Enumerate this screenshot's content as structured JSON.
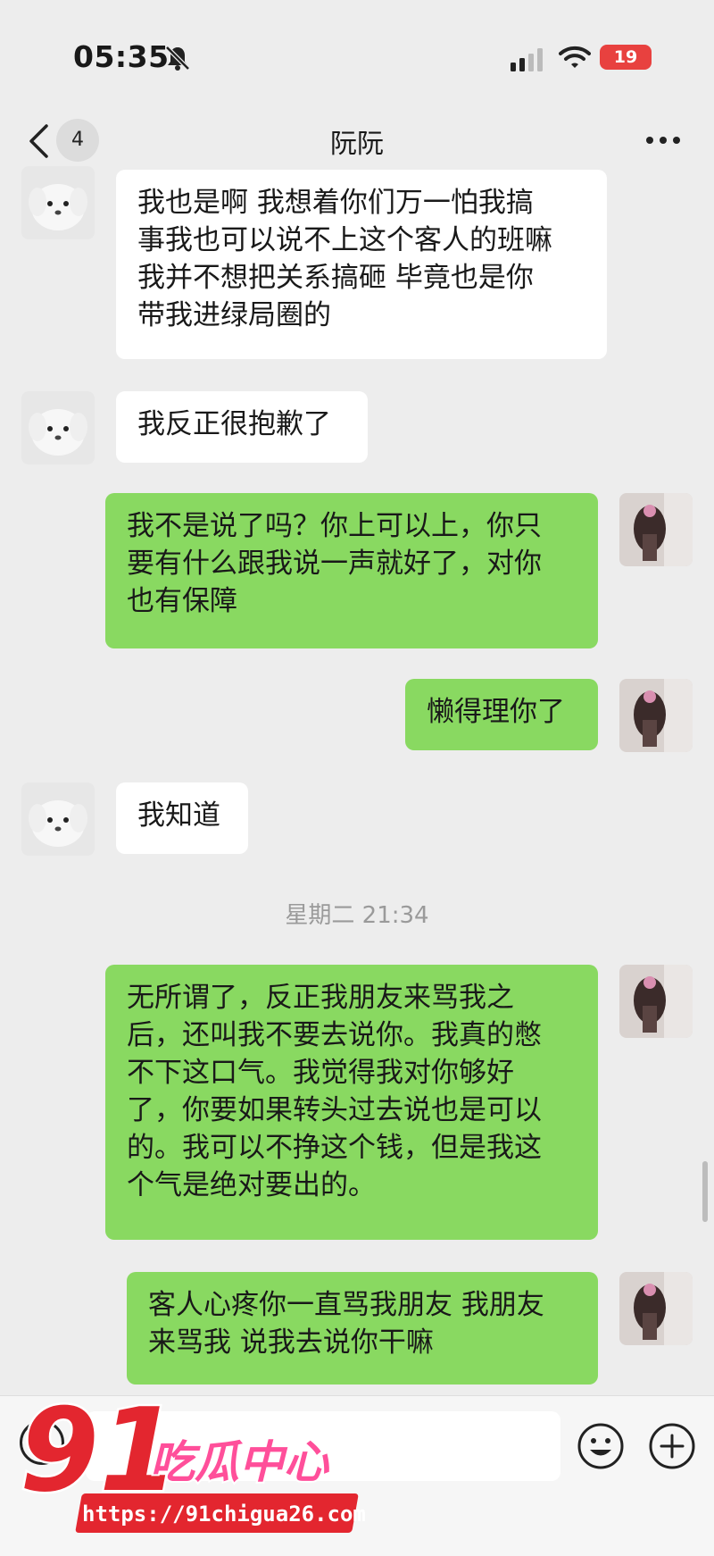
{
  "status_bar": {
    "time": "05:35",
    "battery": "19",
    "icons": [
      "bell-slash-icon",
      "signal-icon",
      "wifi-icon",
      "battery-icon"
    ]
  },
  "nav": {
    "unread_count": "4",
    "title": "阮阮",
    "icons": [
      "chevron-left-icon",
      "more-dots-icon"
    ]
  },
  "messages": [
    {
      "side": "in",
      "text": "我也是啊 我想着你们万一怕我搞\n事我也可以说不上这个客人的班嘛\n我并不想把关系搞砸 毕竟也是你\n带我进绿局圈的"
    },
    {
      "side": "in",
      "text": "我反正很抱歉了"
    },
    {
      "side": "out",
      "text": "我不是说了吗？你上可以上，你只\n要有什么跟我说一声就好了，对你\n也有保障"
    },
    {
      "side": "out",
      "text": "懒得理你了"
    },
    {
      "side": "in",
      "text": "我知道"
    },
    {
      "side": "out",
      "text": "无所谓了，反正我朋友来骂我之\n后，还叫我不要去说你。我真的憋\n不下这口气。我觉得我对你够好\n了，你要如果转头过去说也是可以\n的。我可以不挣这个钱，但是我这\n个气是绝对要出的。"
    },
    {
      "side": "out",
      "text": "客人心疼你一直骂我朋友 我朋友\n来骂我 说我去说你干嘛"
    }
  ],
  "time_separator": "星期二 21:34",
  "input_bar": {
    "placeholder": "",
    "icons": [
      "voice-icon",
      "emoji-icon",
      "plus-icon"
    ]
  },
  "watermark": {
    "logo_number": "91",
    "logo_text": "吃瓜中心",
    "url": "https://91chigua26.com",
    "colors": {
      "red": "#e3262f",
      "pink": "#ff4f9a"
    }
  },
  "colors": {
    "background": "#ededed",
    "incoming_bubble": "#ffffff",
    "outgoing_bubble": "#89d961",
    "battery_low": "#e8413f"
  }
}
